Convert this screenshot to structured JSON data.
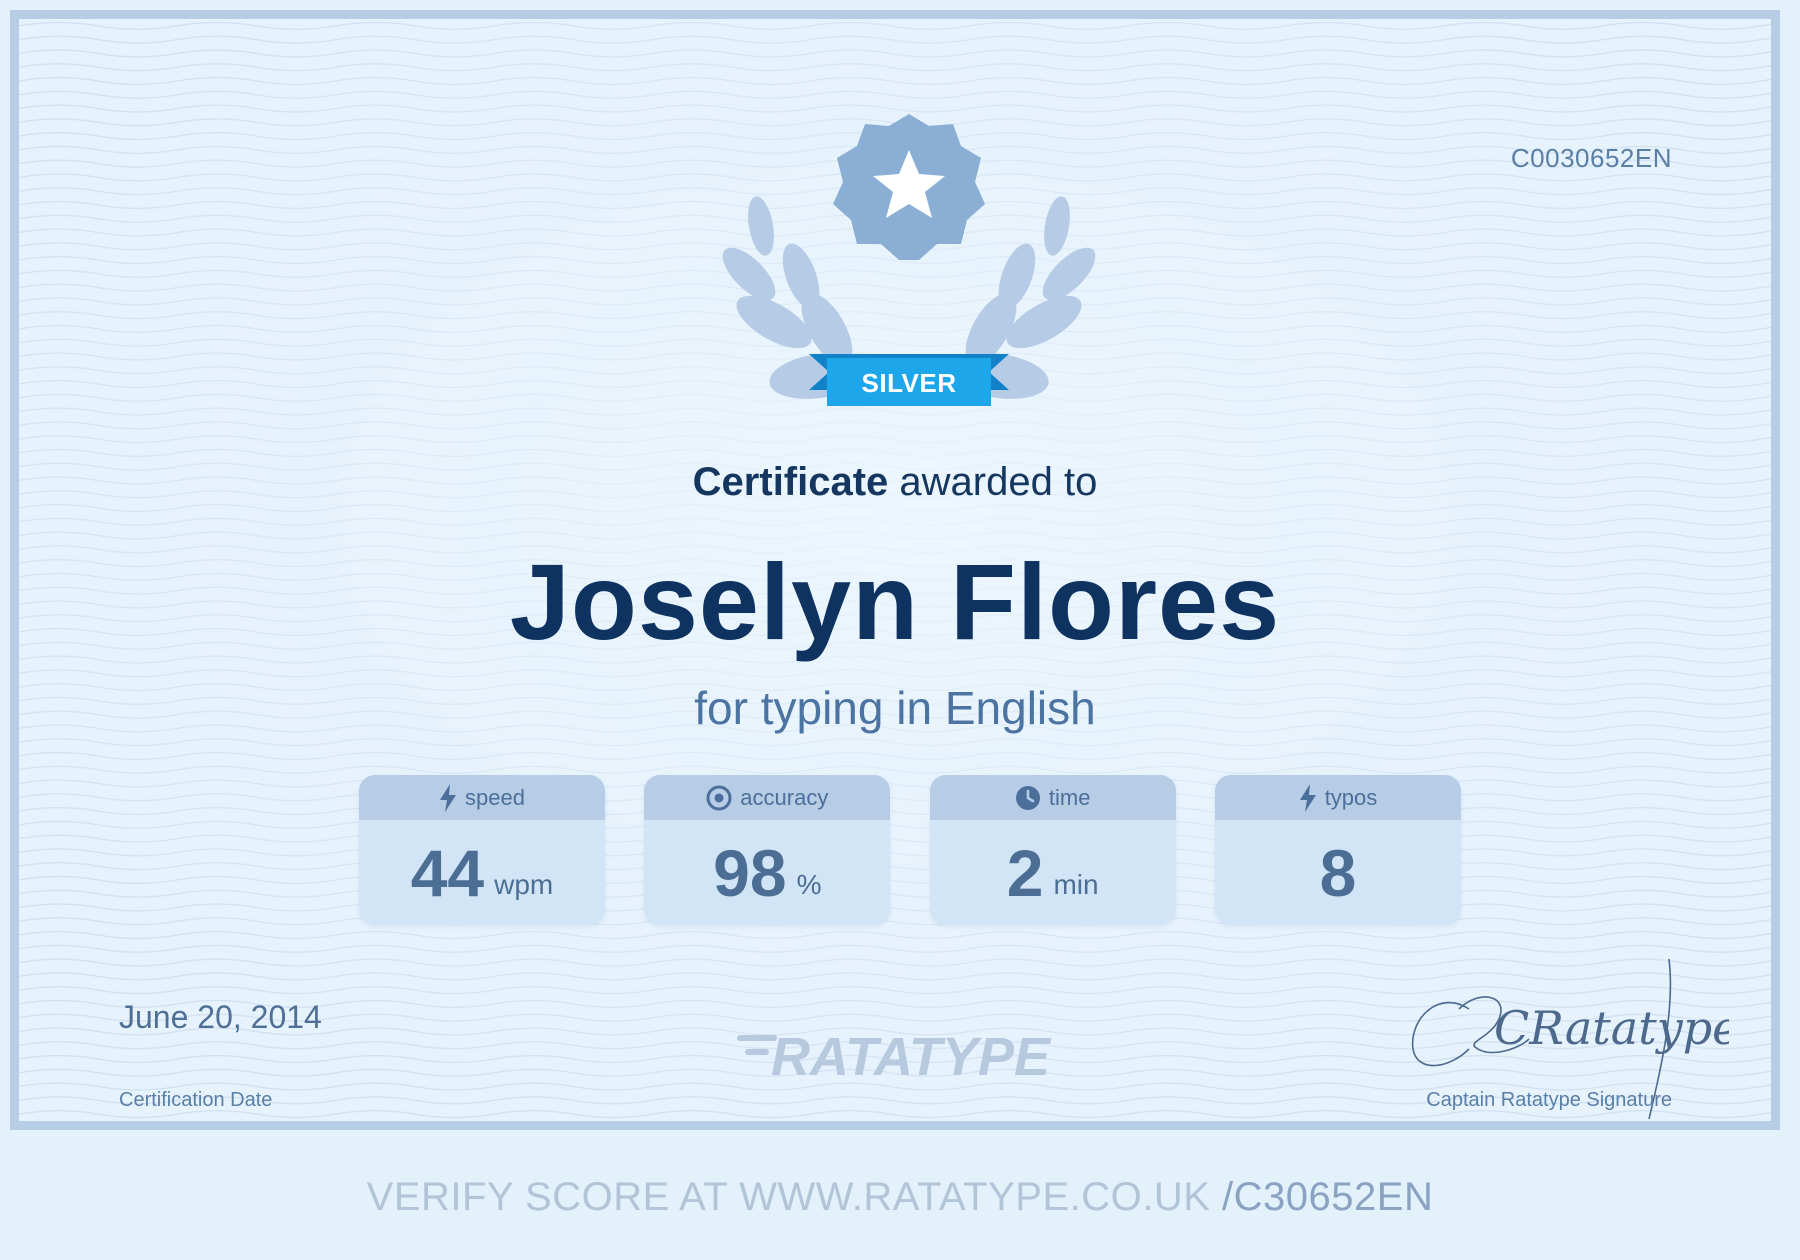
{
  "certificate": {
    "code": "C0030652EN",
    "badge": "SILVER",
    "awarded_strong": "Certificate",
    "awarded_rest": " awarded to",
    "recipient": "Joselyn Flores",
    "subject": "for typing in English"
  },
  "stats": [
    {
      "icon": "lightning-icon",
      "label": "speed",
      "value": "44",
      "unit": "wpm"
    },
    {
      "icon": "target-icon",
      "label": "accuracy",
      "value": "98",
      "unit": "%"
    },
    {
      "icon": "clock-icon",
      "label": "time",
      "value": "2",
      "unit": "min"
    },
    {
      "icon": "lightning-icon",
      "label": "typos",
      "value": "8",
      "unit": ""
    }
  ],
  "footer": {
    "date": "June 20, 2014",
    "date_label": "Certification Date",
    "brand": "RATATYPE",
    "signature_text": "CRatatype fé",
    "signature_label": "Captain Ratatype Signature"
  },
  "verify": {
    "text": "VERIFY SCORE AT WWW.RATATYPE.CO.UK ",
    "code": "/C30652EN"
  },
  "colors": {
    "frame": "#b7cde6",
    "paper": "#e6f2fc",
    "navy": "#0f3360",
    "ribbon": "#1ea6ea",
    "emblem": "#8aaed4",
    "laurel": "#b5cbe6"
  }
}
